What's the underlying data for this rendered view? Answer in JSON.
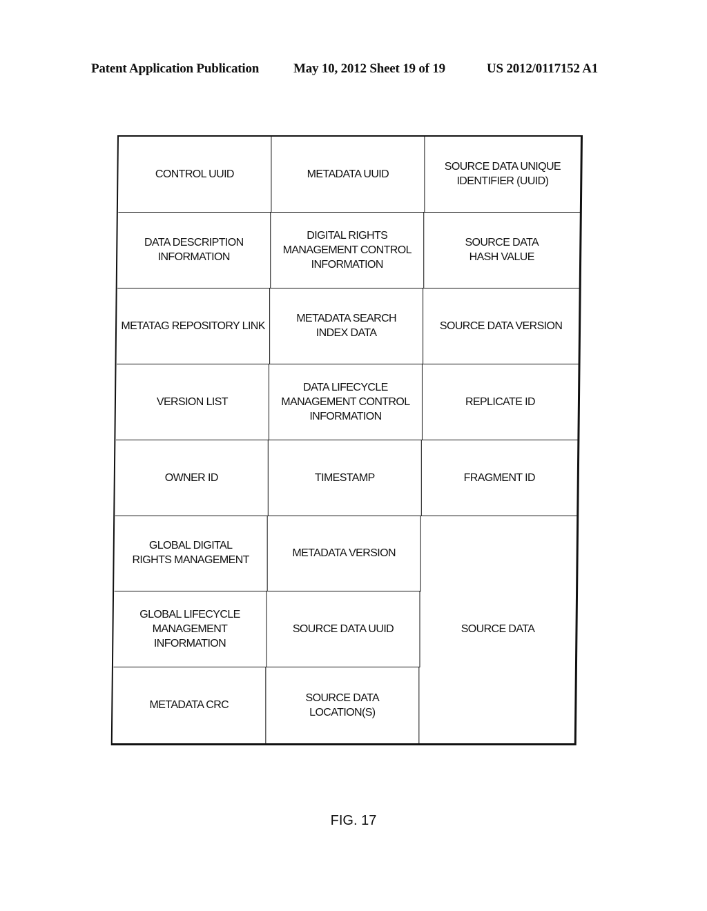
{
  "header": {
    "publication": "Patent Application Publication",
    "date_sheet": "May 10, 2012  Sheet 19 of 19",
    "number": "US 2012/0117152 A1"
  },
  "table": {
    "rows": [
      [
        "CONTROL UUID",
        "METADATA UUID",
        "SOURCE DATA UNIQUE\nIDENTIFIER (UUID)"
      ],
      [
        "DATA DESCRIPTION\nINFORMATION",
        "DIGITAL RIGHTS\nMANAGEMENT CONTROL\nINFORMATION",
        "SOURCE DATA\nHASH VALUE"
      ],
      [
        "METATAG REPOSITORY LINK",
        "METADATA SEARCH\nINDEX DATA",
        "SOURCE DATA VERSION"
      ],
      [
        "VERSION LIST",
        "DATA LIFECYCLE\nMANAGEMENT CONTROL\nINFORMATION",
        "REPLICATE ID"
      ],
      [
        "OWNER ID",
        "TIMESTAMP",
        "FRAGMENT ID"
      ],
      [
        "GLOBAL DIGITAL\nRIGHTS MANAGEMENT",
        "METADATA VERSION"
      ],
      [
        "GLOBAL LIFECYCLE\nMANAGEMENT INFORMATION",
        "SOURCE DATA UUID"
      ],
      [
        "METADATA CRC",
        "SOURCE DATA\nLOCATION(S)"
      ]
    ],
    "spanning_cell": "SOURCE DATA"
  },
  "figure_label": "FIG. 17"
}
